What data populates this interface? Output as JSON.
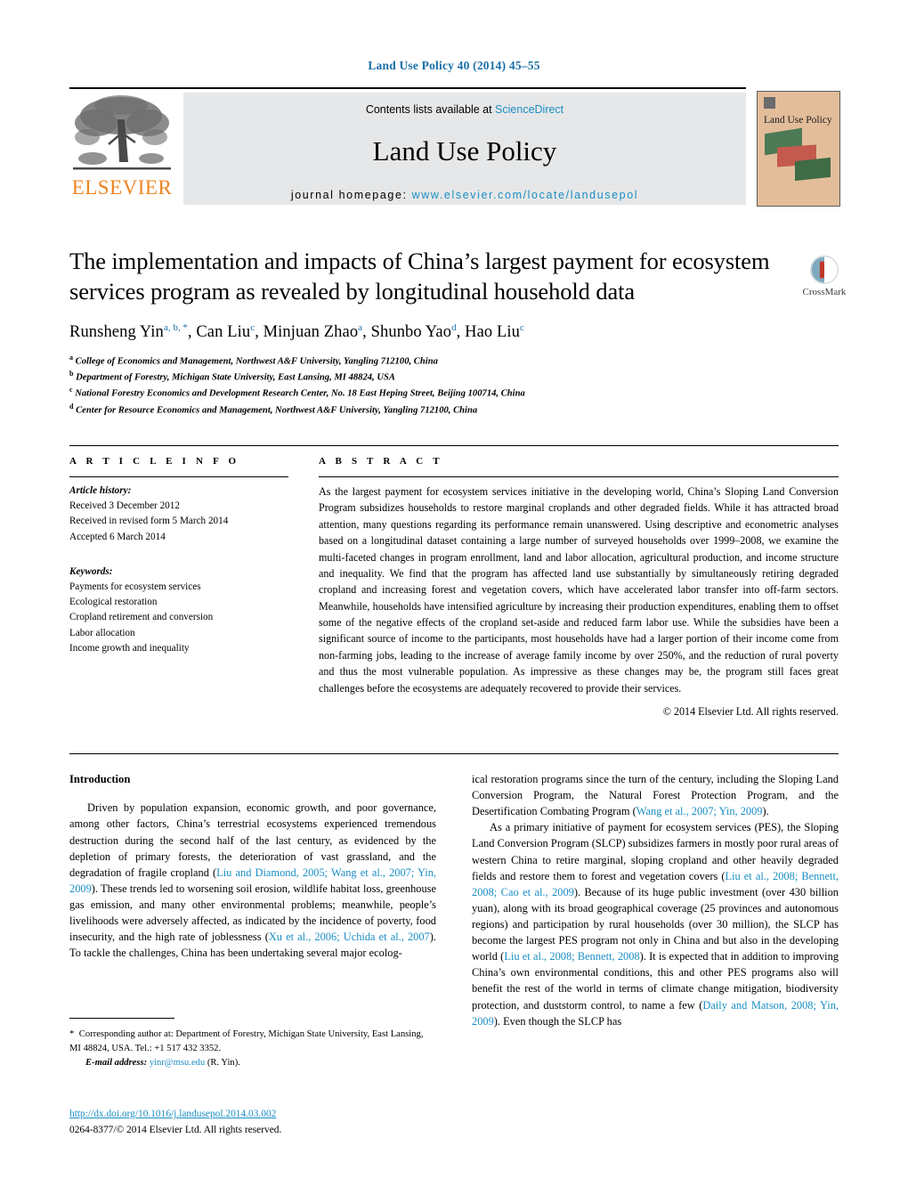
{
  "running_head": "Land Use Policy 40 (2014) 45–55",
  "masthead": {
    "contents_prefix": "Contents lists available at ",
    "sciencedirect": "ScienceDirect",
    "journal_name": "Land Use Policy",
    "homepage_prefix": "journal homepage: ",
    "homepage_url": "www.elsevier.com/locate/landusepol",
    "publisher": "ELSEVIER",
    "cover_title": "Land Use Policy"
  },
  "article": {
    "title": "The implementation and impacts of China’s largest payment for ecosystem services program as revealed by longitudinal household data",
    "authors_html": "Runsheng Yin<sup>a, b, *</sup>, Can Liu<sup>c</sup>, Minjuan Zhao<sup>a</sup>, Shunbo Yao<sup>d</sup>, Hao Liu<sup>c</sup>",
    "affiliations": [
      {
        "marker": "a",
        "text": "College of Economics and Management, Northwest A&F University, Yangling 712100, China"
      },
      {
        "marker": "b",
        "text": "Department of Forestry, Michigan State University, East Lansing, MI 48824, USA"
      },
      {
        "marker": "c",
        "text": "National Forestry Economics and Development Research Center, No. 18 East Heping Street, Beijing 100714, China"
      },
      {
        "marker": "d",
        "text": "Center for Resource Economics and Management, Northwest A&F University, Yangling 712100, China"
      }
    ],
    "crossmark_label": "CrossMark"
  },
  "article_info": {
    "heading": "A R T I C L E   I N F O",
    "history_label": "Article history:",
    "history": [
      "Received 3 December 2012",
      "Received in revised form 5 March 2014",
      "Accepted 6 March 2014"
    ],
    "keywords_label": "Keywords:",
    "keywords": [
      "Payments for ecosystem services",
      "Ecological restoration",
      "Cropland retirement and conversion",
      "Labor allocation",
      "Income growth and inequality"
    ]
  },
  "abstract": {
    "heading": "A B S T R A C T",
    "text": "As the largest payment for ecosystem services initiative in the developing world, China’s Sloping Land Conversion Program subsidizes households to restore marginal croplands and other degraded fields. While it has attracted broad attention, many questions regarding its performance remain unanswered. Using descriptive and econometric analyses based on a longitudinal dataset containing a large number of surveyed households over 1999–2008, we examine the multi-faceted changes in program enrollment, land and labor allocation, agricultural production, and income structure and inequality. We find that the program has affected land use substantially by simultaneously retiring degraded cropland and increasing forest and vegetation covers, which have accelerated labor transfer into off-farm sectors. Meanwhile, households have intensified agriculture by increasing their production expenditures, enabling them to offset some of the negative effects of the cropland set-aside and reduced farm labor use. While the subsidies have been a significant source of income to the participants, most households have had a larger portion of their income come from non-farming jobs, leading to the increase of average family income by over 250%, and the reduction of rural poverty and thus the most vulnerable population. As impressive as these changes may be, the program still faces great challenges before the ecosystems are adequately recovered to provide their services.",
    "rights": "© 2014 Elsevier Ltd. All rights reserved."
  },
  "body": {
    "section_heading": "Introduction",
    "left_paragraphs": [
      "Driven by population expansion, economic growth, and poor governance, among other factors, China’s terrestrial ecosystems experienced tremendous destruction during the second half of the last century, as evidenced by the depletion of primary forests, the deterioration of vast grassland, and the degradation of fragile cropland (<span class=\"cite\">Liu and Diamond, 2005; Wang et al., 2007; Yin, 2009</span>). These trends led to worsening soil erosion, wildlife habitat loss, greenhouse gas emission, and many other environmental problems; meanwhile, people’s livelihoods were adversely affected, as indicated by the incidence of poverty, food insecurity, and the high rate of joblessness (<span class=\"cite\">Xu et al., 2006; Uchida et al., 2007</span>). To tackle the challenges, China has been undertaking several major ecolog-"
    ],
    "right_paragraphs": [
      "ical restoration programs since the turn of the century, including the Sloping Land Conversion Program, the Natural Forest Protection Program, and the Desertification Combating Program (<span class=\"cite\">Wang et al., 2007; Yin, 2009</span>).",
      "As a primary initiative of payment for ecosystem services (PES), the Sloping Land Conversion Program (SLCP) subsidizes farmers in mostly poor rural areas of western China to retire marginal, sloping cropland and other heavily degraded fields and restore them to forest and vegetation covers (<span class=\"cite\">Liu et al., 2008; Bennett, 2008; Cao et al., 2009</span>). Because of its huge public investment (over 430 billion yuan), along with its broad geographical coverage (25 provinces and autonomous regions) and participation by rural households (over 30 million), the SLCP has become the largest PES program not only in China and but also in the developing world (<span class=\"cite\">Liu et al., 2008; Bennett, 2008</span>). It is expected that in addition to improving China’s own environmental conditions, this and other PES programs also will benefit the rest of the world in terms of climate change mitigation, biodiversity protection, and duststorm control, to name a few (<span class=\"cite\">Daily and Matson, 2008; Yin, 2009</span>). Even though the SLCP has"
    ]
  },
  "footnote": {
    "corresponding": "<span class=\"star\">*</span>&nbsp; Corresponding author at: Department of Forestry, Michigan State University, East Lansing, MI 48824, USA. Tel.: +1 517 432 3352.",
    "email_label": "E-mail address:",
    "email": "yinr@msu.edu",
    "email_suffix": "(R. Yin)."
  },
  "footer": {
    "doi": "http://dx.doi.org/10.1016/j.landusepol.2014.03.002",
    "issn_rights": "0264-8377/© 2014 Elsevier Ltd. All rights reserved."
  },
  "colors": {
    "link_blue": "#1a8ec4",
    "head_blue": "#1a6fa8",
    "elsevier_orange": "#ee8422",
    "panel_grey": "#e6e7e8",
    "cover_tan": "#e3bd9a"
  }
}
